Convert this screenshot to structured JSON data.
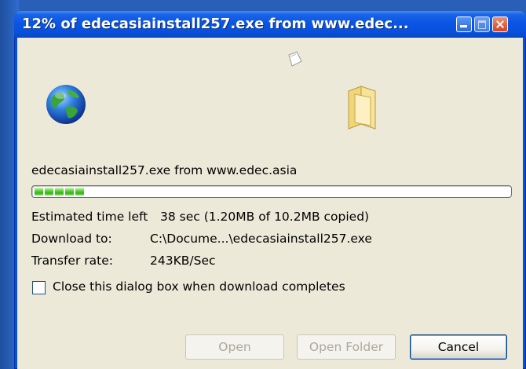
{
  "window": {
    "title": "12% of edecasiainstall257.exe from www.edec...",
    "controls": [
      "minimize-icon",
      "maximize-icon",
      "close-icon"
    ]
  },
  "animation": {
    "icons": [
      "flying-paper-icon",
      "globe-icon",
      "folder-icon"
    ]
  },
  "download": {
    "file_source": "edecasiainstall257.exe from www.edec.asia",
    "progress_percent": 12,
    "progress_blocks": 5,
    "estimated_label": "Estimated time left",
    "estimated_value": "38 sec (1.20MB of 10.2MB copied)",
    "download_to_label": "Download to:",
    "download_to_value": "C:\\Docume...\\edecasiainstall257.exe",
    "transfer_label": "Transfer rate:",
    "transfer_value": "243KB/Sec"
  },
  "options": {
    "close_when_complete_label": "Close this dialog box when download completes",
    "close_when_complete_checked": false
  },
  "buttons": {
    "open": "Open",
    "open_folder": "Open Folder",
    "cancel": "Cancel"
  },
  "colors": {
    "titlebar": "#0a55e4",
    "client_bg": "#ece9d8",
    "progress_green": "#37b21a"
  }
}
